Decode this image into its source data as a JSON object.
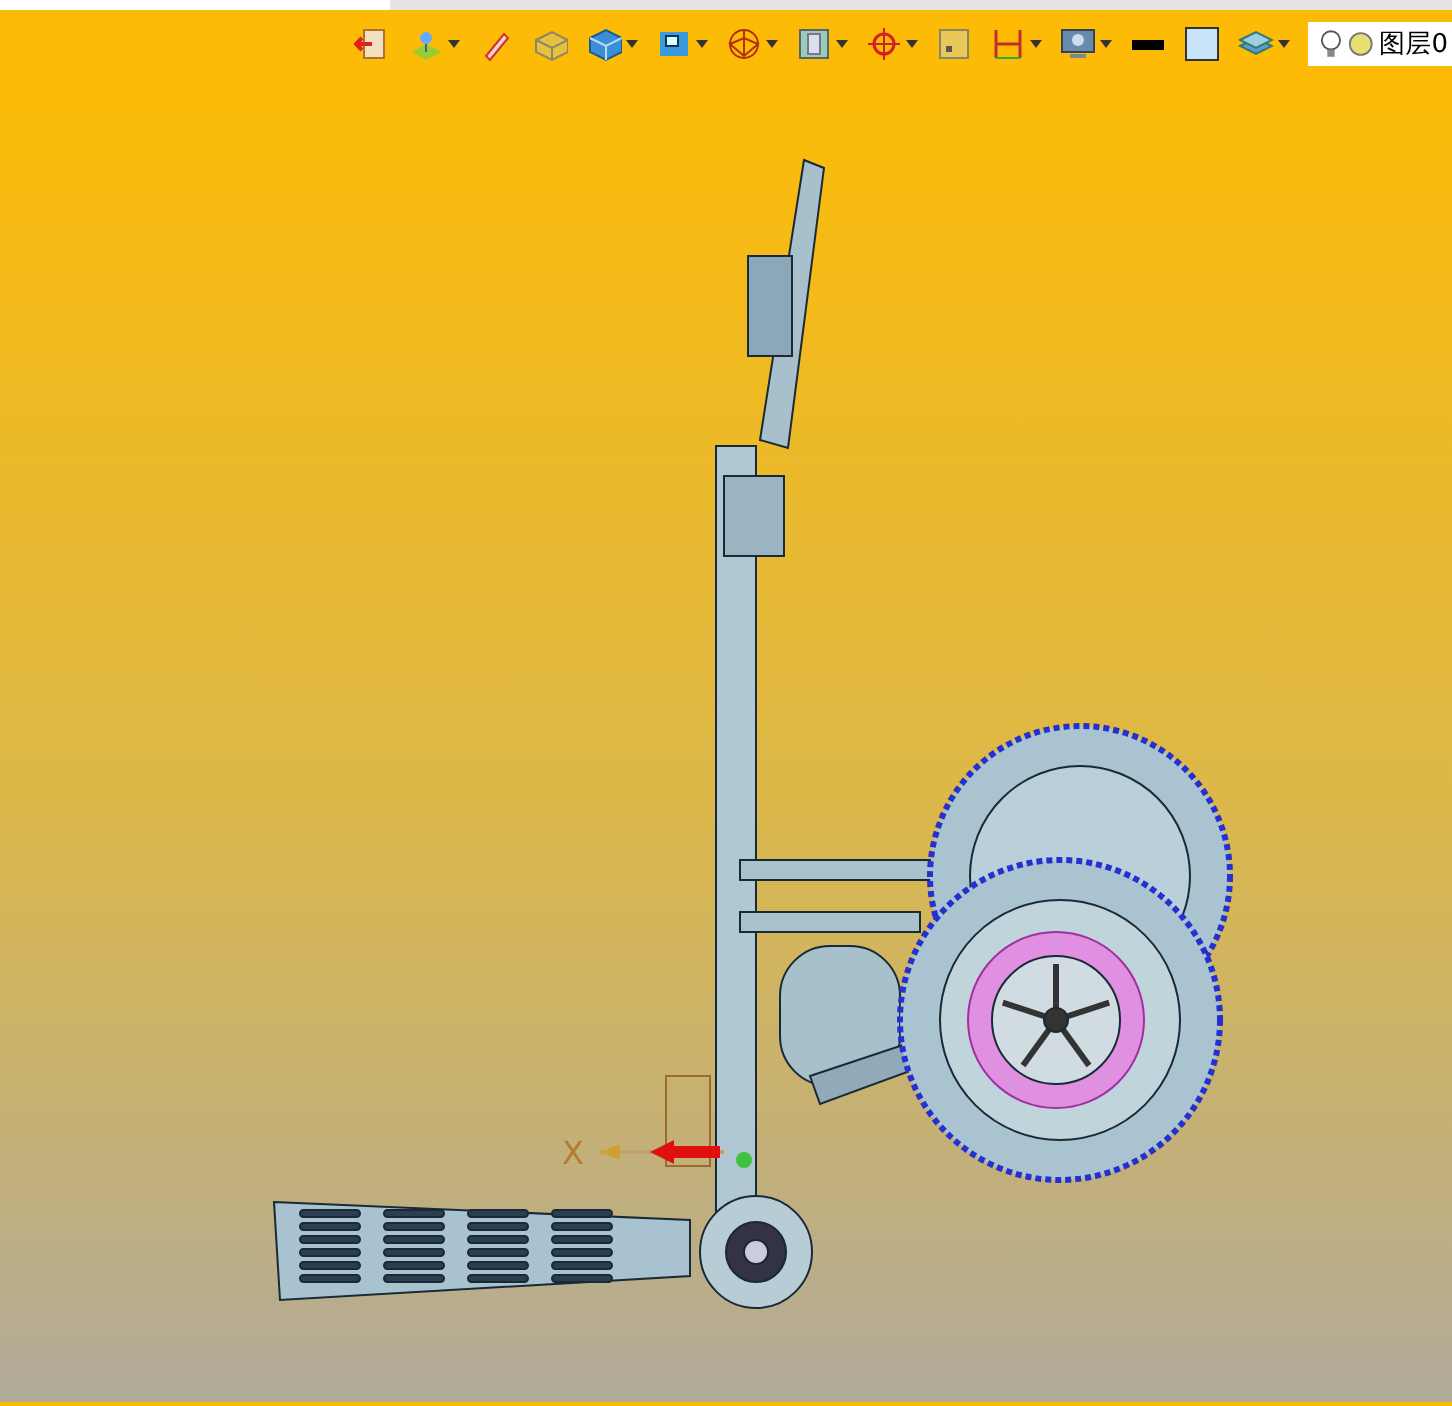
{
  "toolbar": {
    "buttons": [
      {
        "dropdown": false
      },
      {
        "dropdown": true
      },
      {
        "dropdown": false
      },
      {
        "dropdown": false
      },
      {
        "dropdown": true
      },
      {
        "dropdown": true
      },
      {
        "dropdown": true
      },
      {
        "dropdown": true
      },
      {
        "dropdown": true
      },
      {
        "dropdown": false
      },
      {
        "dropdown": true
      },
      {
        "dropdown": true
      },
      {
        "dropdown": false
      },
      {
        "dropdown": false
      },
      {
        "dropdown": true
      }
    ],
    "layer_field": {
      "value": "图层0"
    }
  },
  "viewport": {
    "axis_label": "X"
  }
}
